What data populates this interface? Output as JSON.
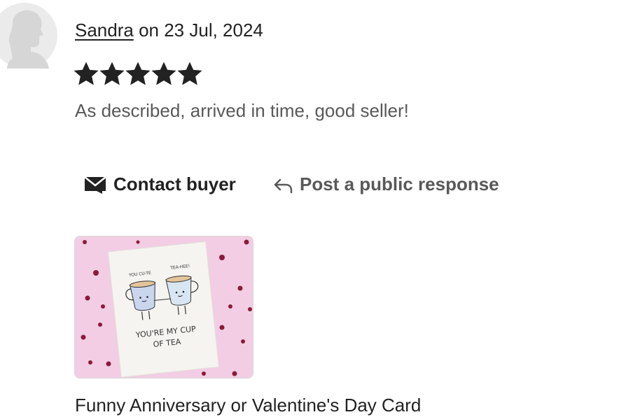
{
  "review": {
    "reviewer_name": "Sandra",
    "date_text": "on 23 Jul, 2024",
    "rating": 5,
    "rating_max": 5,
    "text": "As described, arrived in time, good seller!"
  },
  "actions": {
    "contact_label": "Contact buyer",
    "respond_label": "Post a public response"
  },
  "product": {
    "title": "Funny Anniversary or Valentine's Day Card",
    "card_text_line1": "YOU'RE MY CUP",
    "card_text_line2": "OF TEA",
    "speech_left": "YOU CU-TE",
    "speech_right": "TEA-HEE!"
  },
  "colors": {
    "text": "#222222",
    "muted": "#595959",
    "star": "#222222",
    "card_background_pink": "#f2cde3",
    "heart": "#8b1a3a"
  },
  "icons": {
    "avatar": "default-avatar-icon",
    "star": "star-icon",
    "contact": "envelope-icon",
    "respond": "reply-arrow-icon"
  }
}
